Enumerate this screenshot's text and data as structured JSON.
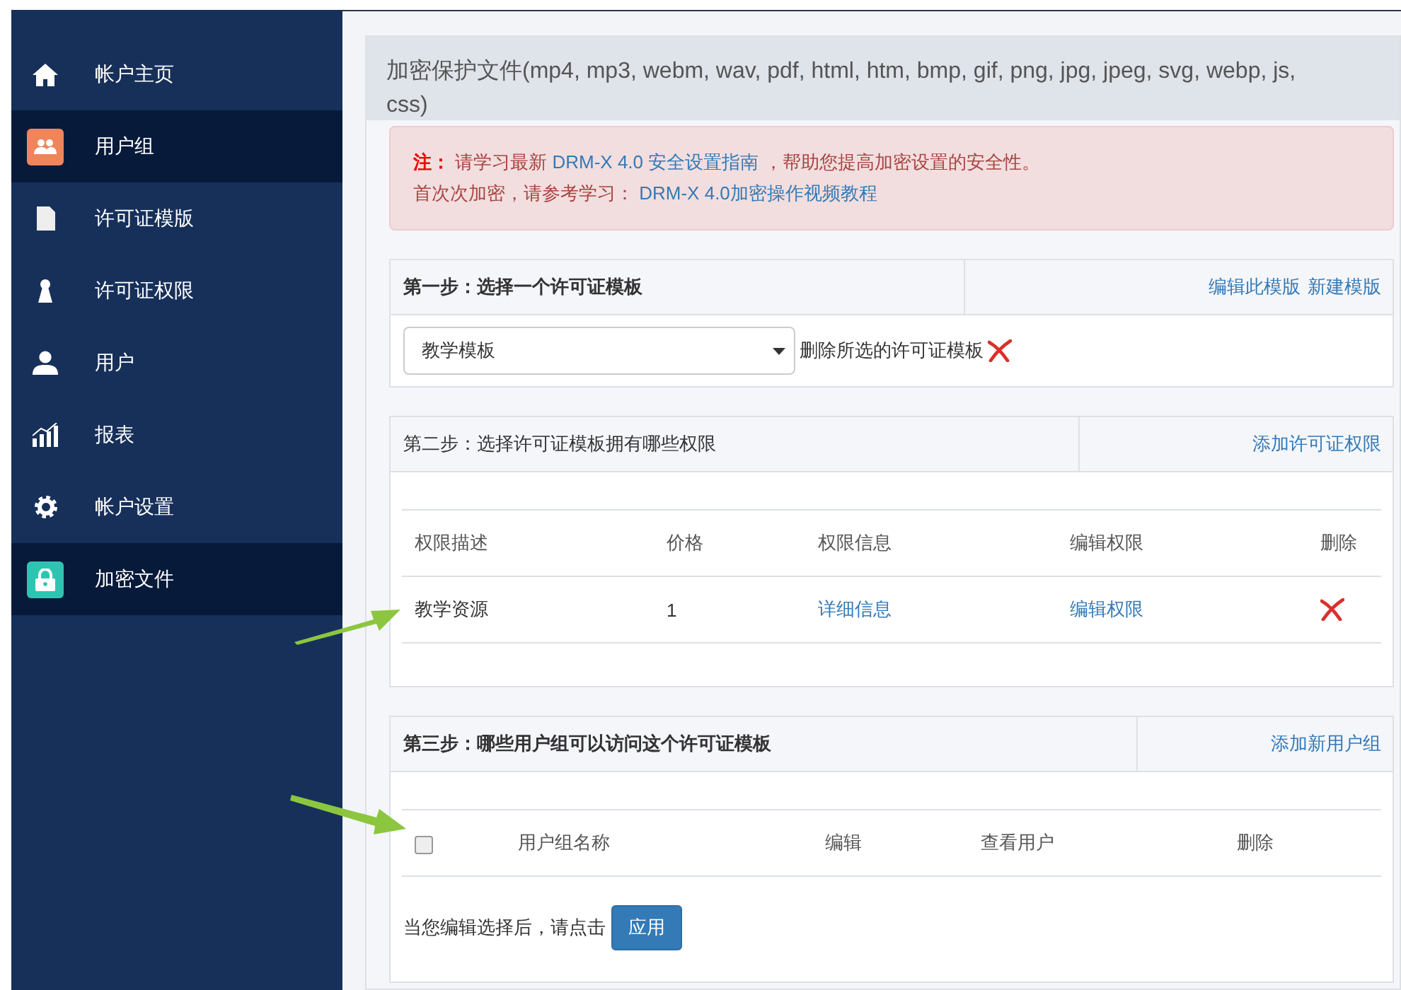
{
  "sidebar": {
    "items": [
      {
        "label": "帐户主页",
        "selected": false
      },
      {
        "label": "用户组",
        "selected": true
      },
      {
        "label": "许可证模版",
        "selected": false
      },
      {
        "label": "许可证权限",
        "selected": false
      },
      {
        "label": "用户",
        "selected": false
      },
      {
        "label": "报表",
        "selected": false
      },
      {
        "label": "帐户设置",
        "selected": false
      },
      {
        "label": "加密文件",
        "selected": true
      }
    ]
  },
  "panel": {
    "title": "加密保护文件(mp4, mp3, webm, wav, pdf, html, htm, bmp, gif, png, jpg, jpeg, svg, webp, js, css)"
  },
  "notice": {
    "prefix": "注：",
    "line1_before": "请学习最新",
    "line1_link": "DRM-X 4.0 安全设置指南",
    "line1_after": "，帮助您提高加密设置的安全性。",
    "line2_before": "首次次加密，请参考学习：",
    "line2_link": "DRM-X 4.0加密操作视频教程"
  },
  "step1": {
    "title": "第一步：选择一个许可证模板",
    "actions": [
      "编辑此模版",
      "新建模版"
    ],
    "select": {
      "value": "教学模板"
    },
    "delete_label": "删除所选的许可证模板"
  },
  "step2": {
    "title": "第二步：选择许可证模板拥有哪些权限",
    "actions": [
      "添加许可证权限"
    ],
    "table": {
      "columns": [
        "权限描述",
        "价格",
        "权限信息",
        "编辑权限",
        "删除"
      ],
      "rows": [
        {
          "cells": [
            {
              "kind": "text",
              "text": "教学资源"
            },
            {
              "kind": "text",
              "text": "1"
            },
            {
              "kind": "link",
              "text": "详细信息"
            },
            {
              "kind": "link",
              "text": "编辑权限"
            },
            {
              "kind": "delete"
            }
          ]
        }
      ]
    }
  },
  "step3": {
    "title": "第三步：哪些用户组可以访问这个许可证模板",
    "actions": [
      "添加新用户组"
    ],
    "table": {
      "select_all": {
        "checked": false
      },
      "columns": [
        "用户组名称",
        "编辑",
        "查看用户",
        "删除"
      ]
    },
    "footer_text": "当您编辑选择后，请点击",
    "apply_button": "应用"
  }
}
